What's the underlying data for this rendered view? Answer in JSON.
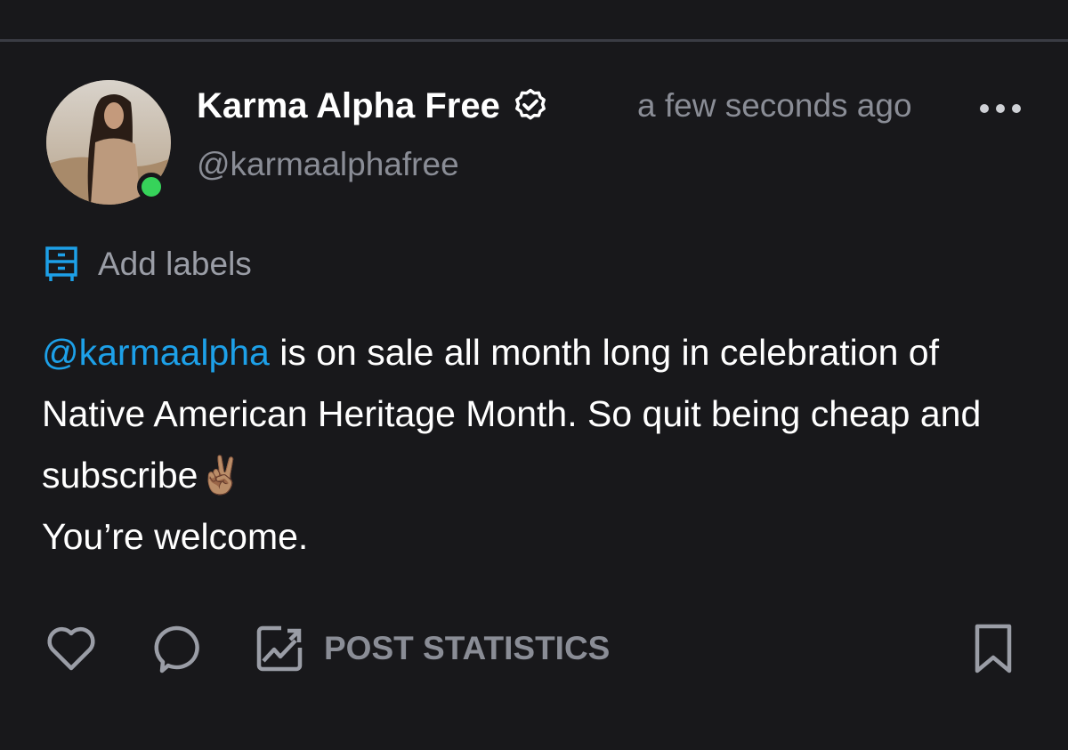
{
  "colors": {
    "background": "#18181b",
    "accent": "#1da0e8",
    "muted_text": "#8a8d96",
    "online": "#36d35a"
  },
  "post": {
    "author": {
      "display_name": "Karma Alpha Free",
      "handle": "@karmaalphafree",
      "verified_icon": "verified-badge-icon",
      "online": true
    },
    "timestamp": "a few seconds ago",
    "menu_icon": "more-horizontal-icon",
    "labels": {
      "icon": "labels-icon",
      "text": "Add labels"
    },
    "body": {
      "mention": "@karmaalpha",
      "line1_rest": " is on sale all month long in celebration of Native American Heritage Month. So quit being cheap and subscribe",
      "emoji": "✌🏽",
      "line2": "You’re welcome."
    },
    "actions": {
      "like_icon": "heart-icon",
      "comment_icon": "comment-icon",
      "stats_icon": "chart-image-icon",
      "stats_label": "POST STATISTICS",
      "bookmark_icon": "bookmark-icon"
    }
  }
}
